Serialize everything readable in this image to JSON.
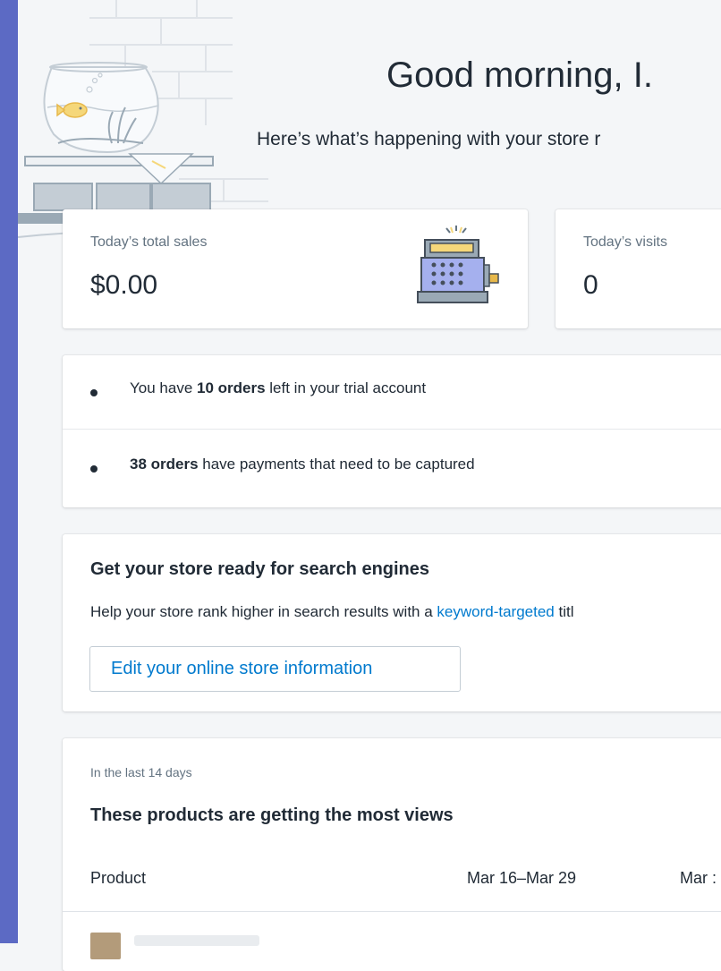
{
  "greeting": "Good morning, I.",
  "subgreeting": "Here’s what’s happening with your store r",
  "stats": [
    {
      "label": "Today’s total sales",
      "value": "$0.00"
    },
    {
      "label": "Today’s visits",
      "value": "0"
    }
  ],
  "notices": [
    {
      "bold": "10 orders",
      "prefix": "You have ",
      "suffix": " left in your trial account"
    },
    {
      "bold": "38 orders",
      "prefix": "",
      "suffix": " have payments that need to be captured"
    }
  ],
  "seo": {
    "title": "Get your store ready for search engines",
    "desc_prefix": "Help your store rank higher in search results with a ",
    "desc_link": "keyword-targeted",
    "desc_suffix": " titl",
    "button_label": "Edit your online store information"
  },
  "products": {
    "subtitle": "In the last 14 days",
    "title": "These products are getting the most views",
    "columns": [
      "Product",
      "Mar 16–Mar 29",
      "Mar :"
    ]
  },
  "colors": {
    "accent": "#5c6ac4",
    "link": "#007ace"
  },
  "icons": {
    "hero": "fishbowl-illustration",
    "register": "cash-register-icon"
  }
}
